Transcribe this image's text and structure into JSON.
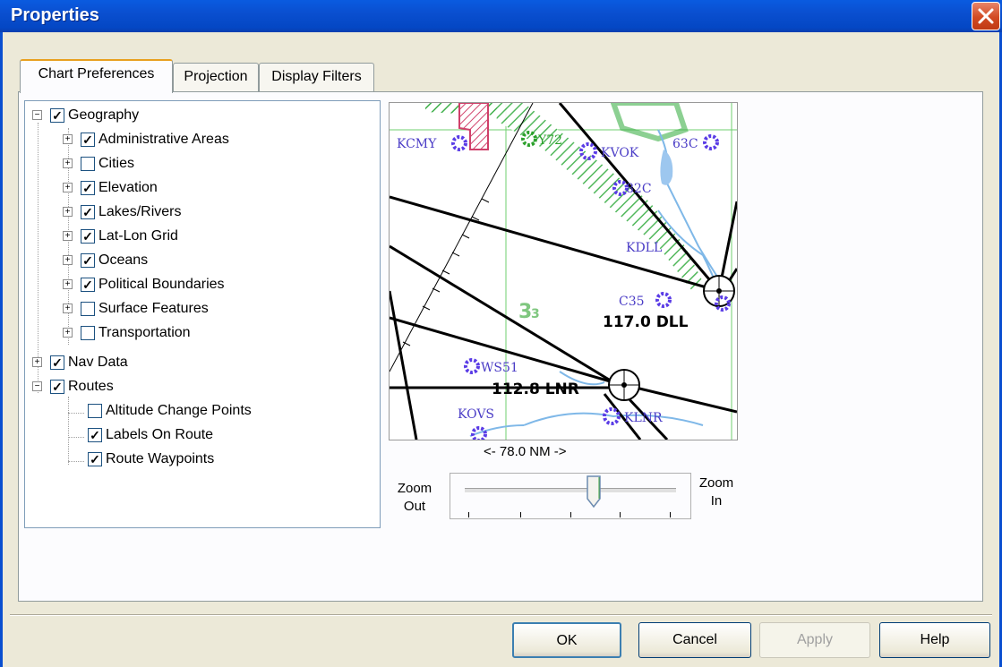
{
  "window": {
    "title": "Properties"
  },
  "tabs": [
    {
      "label": "Chart Preferences",
      "active": true
    },
    {
      "label": "Projection",
      "active": false
    },
    {
      "label": "Display Filters",
      "active": false
    }
  ],
  "tree": {
    "geography": {
      "label": "Geography",
      "checked": true,
      "expanded": true
    },
    "geography_children": [
      {
        "label": "Administrative Areas",
        "checked": true
      },
      {
        "label": "Cities",
        "checked": false
      },
      {
        "label": "Elevation",
        "checked": true
      },
      {
        "label": "Lakes/Rivers",
        "checked": true
      },
      {
        "label": "Lat-Lon Grid",
        "checked": true
      },
      {
        "label": "Oceans",
        "checked": true
      },
      {
        "label": "Political Boundaries",
        "checked": true
      },
      {
        "label": "Surface Features",
        "checked": false
      },
      {
        "label": "Transportation",
        "checked": false
      }
    ],
    "navdata": {
      "label": "Nav Data",
      "checked": true,
      "expanded": false
    },
    "routes": {
      "label": "Routes",
      "checked": true,
      "expanded": true
    },
    "routes_children": [
      {
        "label": "Altitude Change Points",
        "checked": false
      },
      {
        "label": "Labels On Route",
        "checked": true
      },
      {
        "label": "Route Waypoints",
        "checked": true
      }
    ]
  },
  "map": {
    "labels": {
      "kcmy": "KCMY",
      "y72": "Y72",
      "kvok": "KVOK",
      "c63": "63C",
      "c82": "82C",
      "kdll": "KDLL",
      "c35": "C35",
      "dll": "117.0 DLL",
      "lnr": "112.8 LNR",
      "ws51": "WS51",
      "kovs": "KOVS",
      "klnr": "KLNR",
      "num": "3",
      "numsmall": "3"
    }
  },
  "scale_text": "<- 78.0 NM ->",
  "zoom": {
    "out_label_1": "Zoom",
    "out_label_2": "Out",
    "in_label_1": "Zoom",
    "in_label_2": "In",
    "level_fraction": 0.64
  },
  "buttons": {
    "ok": "OK",
    "cancel": "Cancel",
    "apply": "Apply",
    "help": "Help"
  },
  "colors": {
    "titlebar": "#0a4fd0",
    "dialog_bg": "#ece9d8",
    "airport_symbol": "#5a3ce6",
    "route_line": "#000000",
    "boundary_hatch": "#3fb04a",
    "restricted_area": "#d0406a",
    "water": "#7fb8e8",
    "grid": "#6fcf6f"
  }
}
